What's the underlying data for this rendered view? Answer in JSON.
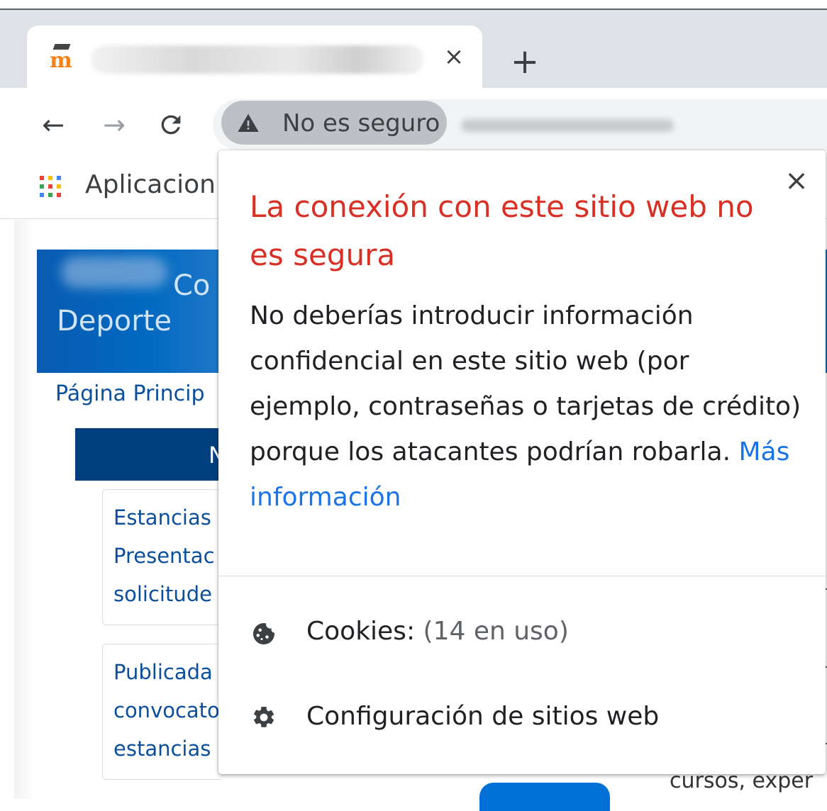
{
  "browser": {
    "tab": {
      "favicon_text": "m",
      "close_glyph": "×"
    },
    "new_tab_glyph": "+",
    "toolbar": {
      "back_glyph": "←",
      "forward_glyph": "→",
      "reload_glyph": "C",
      "security_chip_label": "No es seguro"
    },
    "bookmarks": {
      "apps_label": "Aplicacion"
    }
  },
  "page": {
    "banner_line1": "Co",
    "banner_line2": "Deporte",
    "breadcrumb": "Página Princip",
    "section_header_fragment": "N",
    "news": [
      {
        "lines": [
          "Estancias",
          "Presentac",
          "solicitude"
        ]
      },
      {
        "lines": [
          "Publicada",
          "convocato",
          "estancias"
        ]
      }
    ],
    "bottom_text": "cursos,    exper"
  },
  "popup": {
    "close_glyph": "×",
    "title": "La conexión con este sitio web no es segura",
    "body": "No deberías introducir información confidencial en este sitio web (por ejemplo, contraseñas o tarjetas de crédito) porque los atacantes podrían robarla.",
    "link": "Más información",
    "cookies": {
      "label": "Cookies:",
      "detail": "(14 en uso)"
    },
    "site_settings": {
      "label": "Configuración de sitios web"
    }
  },
  "colors": {
    "title_red": "#d93025",
    "link_blue": "#1a73e8",
    "banner_blue": "#0069c0",
    "navy": "#003e7e"
  }
}
